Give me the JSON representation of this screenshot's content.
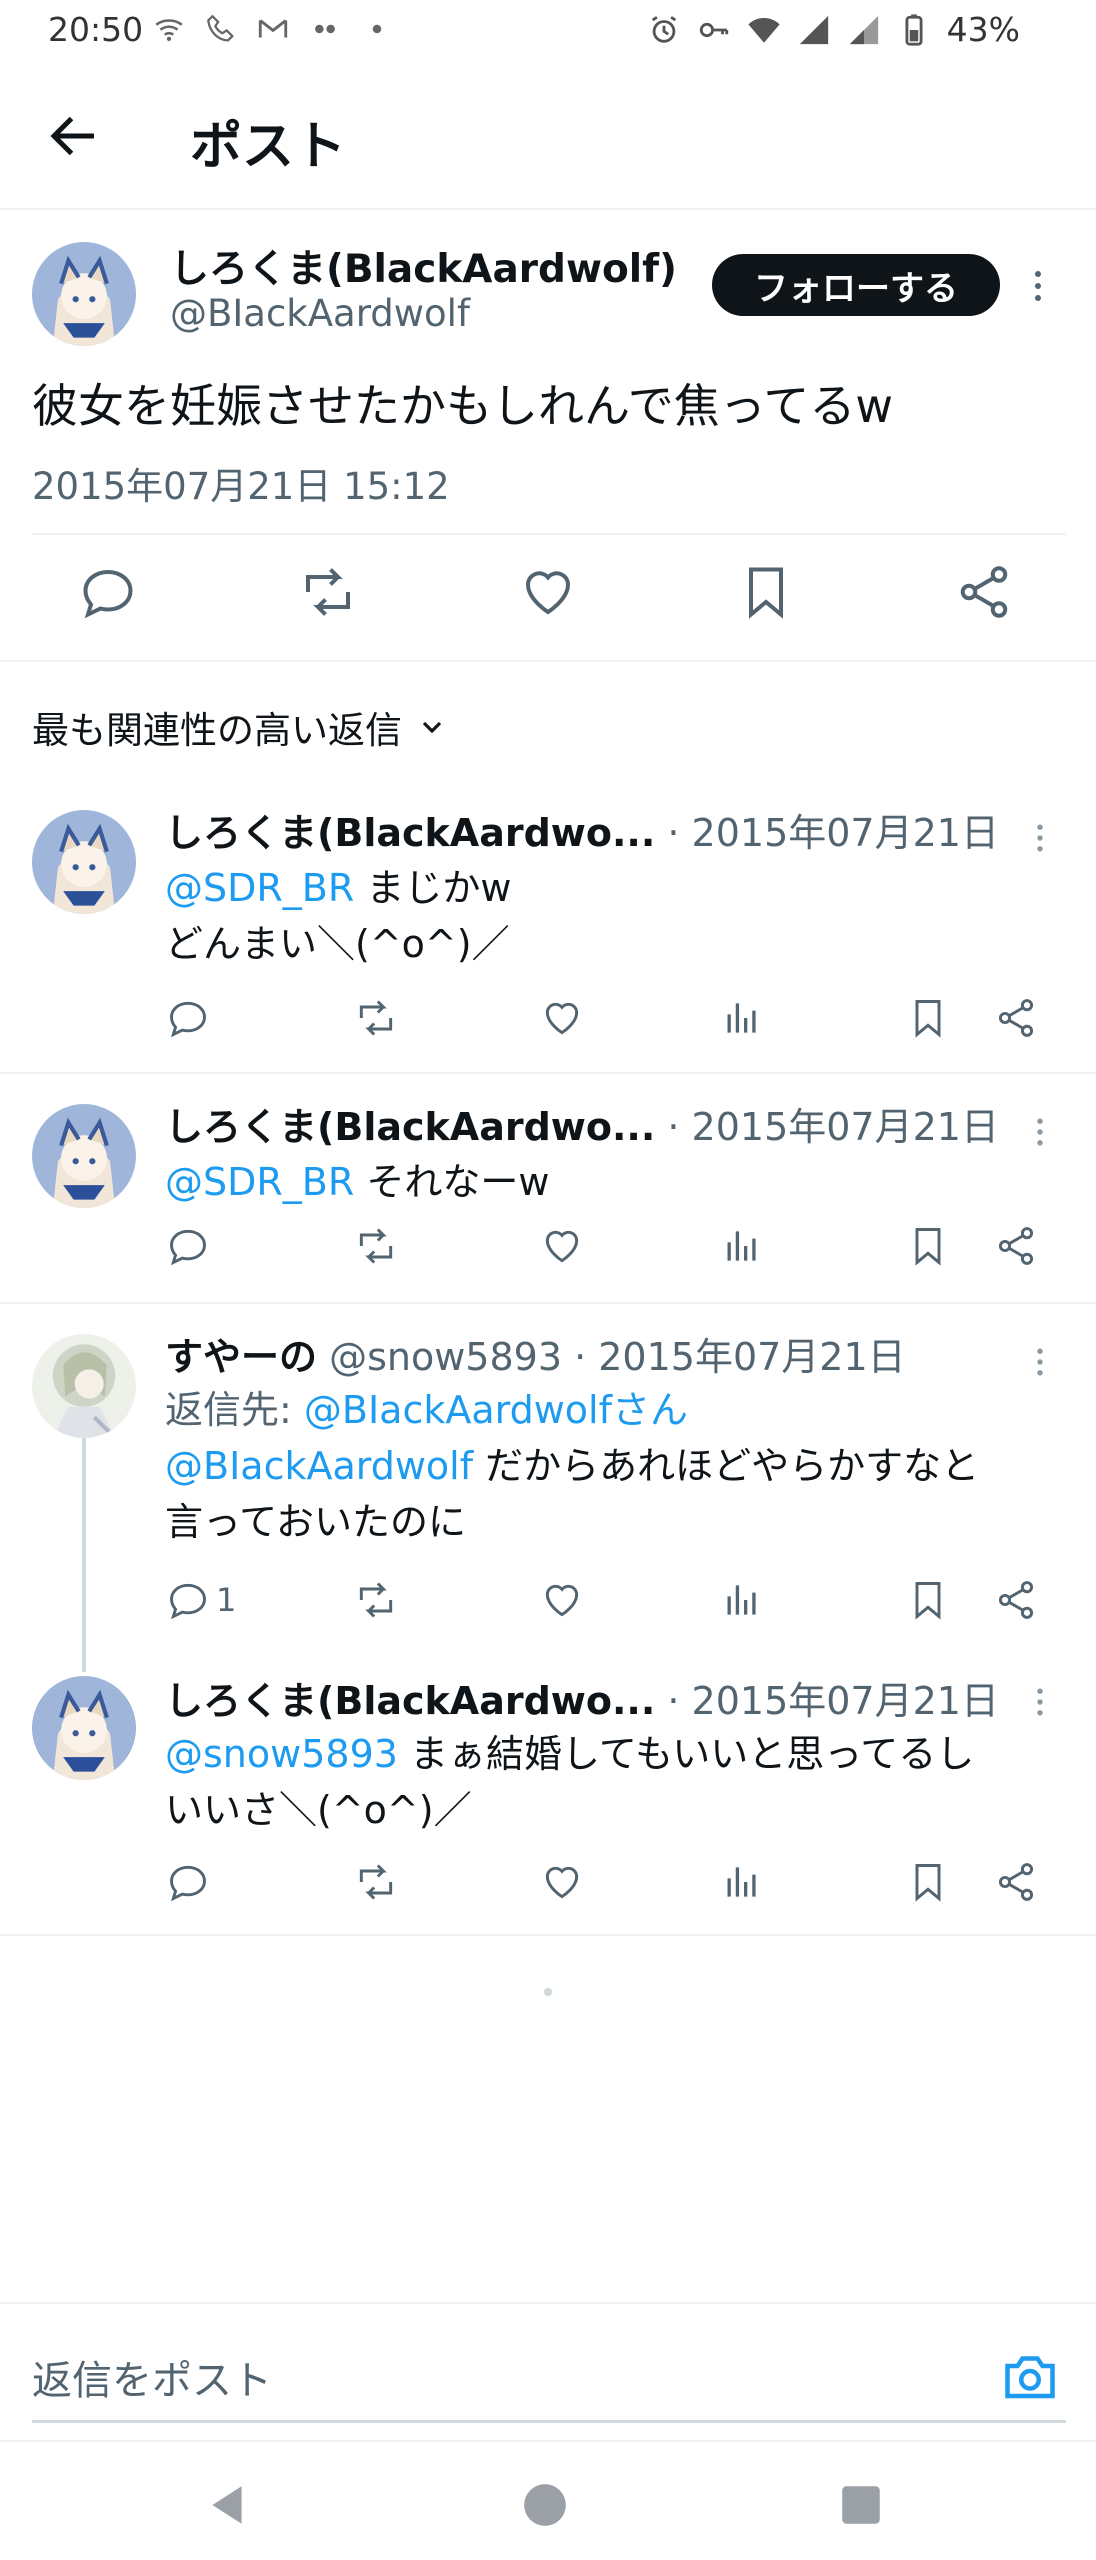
{
  "status_bar": {
    "time": "20:50",
    "battery": "43%"
  },
  "header": {
    "title": "ポスト"
  },
  "main_post": {
    "display_name": "しろくま(BlackAardwolf)",
    "handle": "@BIackAardwolf",
    "follow_label": "フォローする",
    "text": "彼女を妊娠させたかもしれんで焦ってるw",
    "timestamp": "2015年07月21日 15:12"
  },
  "sort": {
    "label": "最も関連性の高い返信"
  },
  "replies": [
    {
      "display_name": "しろくま(BlackAardwo...",
      "meta": " · 2015年07月21日",
      "mention": "@SDR_BR",
      "text": " まじかw",
      "line2": "どんまい＼(^o^)／"
    },
    {
      "display_name": "しろくま(BlackAardwo...",
      "meta": " · 2015年07月21日",
      "mention": "@SDR_BR",
      "text": " それなーw"
    },
    {
      "display_name": "すやーの",
      "meta": " @snow5893 · 2015年07月21日",
      "reply_to_prefix": "返信先: ",
      "reply_to": "@BIackAardwolfさん",
      "mention": "@BIackAardwolf",
      "text": " だからあれほどやらかすなと",
      "line2": "言っておいたのに",
      "reply_count": "1"
    },
    {
      "display_name": "しろくま(BlackAardwo...",
      "meta": " · 2015年07月21日",
      "mention": "@snow5893",
      "text": " まぁ結婚してもいいと思ってるし",
      "line2": "いいさ＼(^o^)／"
    }
  ],
  "composer": {
    "placeholder": "返信をポスト"
  },
  "colors": {
    "accent": "#1d9bf0",
    "text": "#0f1419",
    "muted": "#536471"
  },
  "icons": [
    "back-arrow-icon",
    "more-icon",
    "reply-icon",
    "repost-icon",
    "like-icon",
    "bookmark-icon",
    "share-icon",
    "views-icon",
    "chevron-down-icon",
    "camera-icon"
  ]
}
